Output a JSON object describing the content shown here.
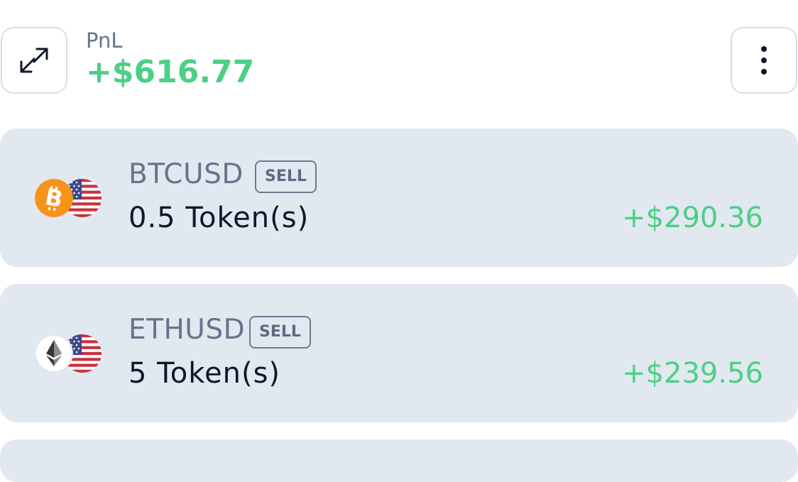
{
  "header": {
    "pnl_label": "PnL",
    "pnl_value": "+$616.77",
    "swap_icon": "swap-arrows-icon",
    "more_icon": "more-vertical-icon"
  },
  "colors": {
    "positive": "#4ccf86",
    "card_bg": "#e2e8f0",
    "muted_text": "#64748b"
  },
  "positions": [
    {
      "symbol": "BTCUSD",
      "side": "SELL",
      "amount": "0.5 Token(s)",
      "pnl": "+$290.36",
      "base_icon": "bitcoin-icon",
      "quote_icon": "us-flag-icon"
    },
    {
      "symbol": "ETHUSD",
      "side": "SELL",
      "amount": "5 Token(s)",
      "pnl": "+$239.56",
      "base_icon": "ethereum-icon",
      "quote_icon": "us-flag-icon"
    }
  ]
}
